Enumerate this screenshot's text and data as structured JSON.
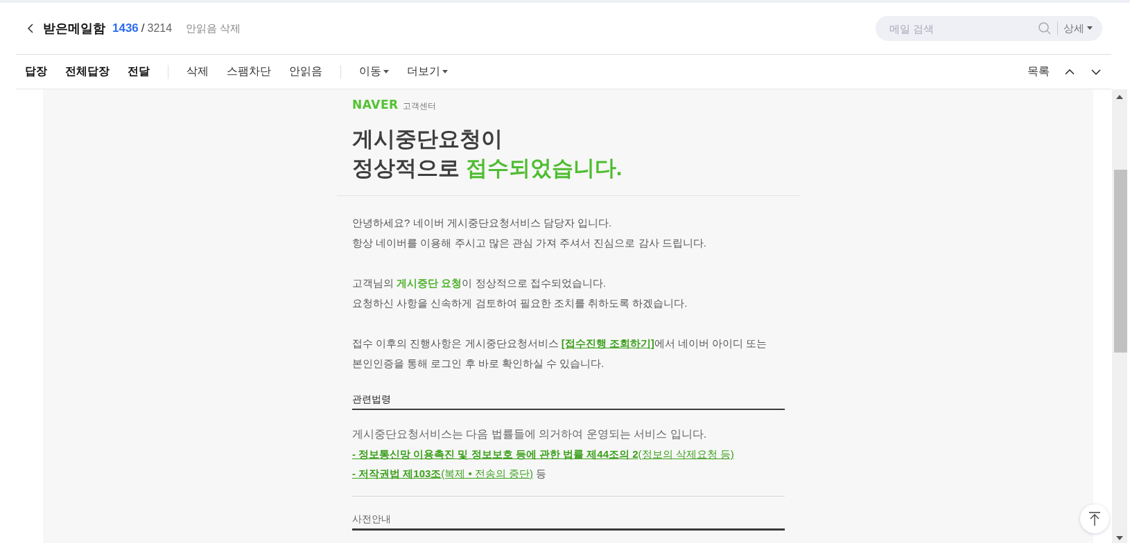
{
  "header": {
    "back_label": "받은메일함",
    "unread_count": "1436",
    "separator": "/",
    "total_count": "3214",
    "action": "안읽음 삭제"
  },
  "search": {
    "placeholder": "메일 검색",
    "detail": "상세"
  },
  "toolbar": {
    "groups": [
      [
        "답장",
        "전체답장",
        "전달"
      ],
      [
        "삭제",
        "스팸차단",
        "안읽음"
      ]
    ],
    "dropdowns": [
      "이동",
      "더보기"
    ],
    "list": "목록"
  },
  "email": {
    "brand": "NAVER",
    "brand_sub": "고객센터",
    "title_lines": [
      "게시중단요청이",
      "정상적으로 **접수되었습니다.**"
    ],
    "paragraphs": [
      {
        "lines": [
          "안녕하세요? 네이버 게시중단요청서비스 담당자 입니다.",
          "항상 네이버를 이용해 주시고 많은 관심 가져 주셔서 진심으로 감사 드립니다."
        ]
      },
      {
        "lines": [
          "고객님의 **게시중단 요청**이 정상적으로 접수되었습니다.",
          "요청하신 사항을 신속하게 검토하여 필요한 조치를 취하도록 하겠습니다."
        ]
      },
      {
        "before": "접수 이후의 진행사항은 게시중단요청서비스 ",
        "link": "[접수진행 조회하기]",
        "after": "에서 네이버 아이디 또는",
        "lines": [
          "본인인증을 통해 로그인 후 바로 확인하실 수 있습니다."
        ]
      }
    ],
    "law_section": {
      "heading": "관련법령",
      "intro": "게시중단요청서비스는 다음 법률들에 의거하여 운영되는 서비스 입니다.",
      "links": [
        {
          "text": "**- 정보통신망 이용촉진 및 정보보호 등에 관한 법률 제44조의 2**(정보의 삭제요청 등)"
        },
        {
          "text": "**- 저작권법 제103조**(복제 • 전송의 중단)",
          "suffix": " 등"
        }
      ]
    },
    "next_section": {
      "heading": "사전안내"
    }
  }
}
